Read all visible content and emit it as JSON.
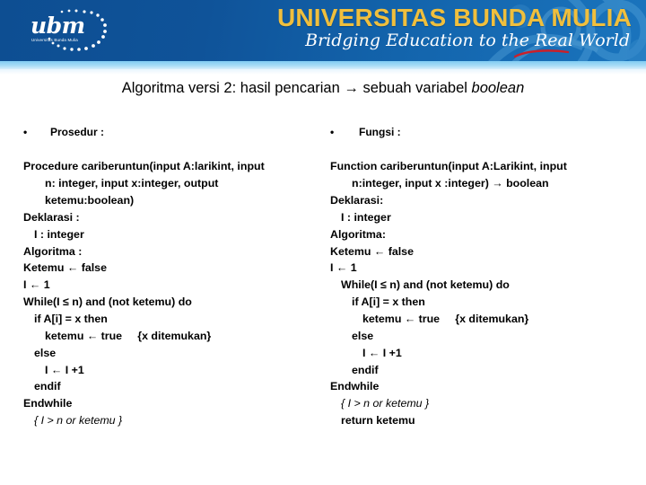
{
  "header": {
    "logo": {
      "mark_text": "ubm",
      "mark_sub": "Universitas Bunda Mulia"
    },
    "university_name": "UNIVERSITAS BUNDA MULIA",
    "tagline": "Bridging Education to the Real World",
    "colors": {
      "banner_dark": "#0d4e92",
      "banner_light": "#1a74bd",
      "strip": "#7fcbf2",
      "gold": "#f0bf3d",
      "swoosh_red": "#c9202a"
    }
  },
  "title": {
    "part1": "Algoritma versi 2: hasil pencarian ",
    "arrow": "→",
    "part2": " sebuah variabel ",
    "emphasis": "boolean"
  },
  "left_column": {
    "bullet": "•",
    "heading": "Prosedur :",
    "code_lines": [
      {
        "text": "Procedure cariberuntun(input A:larikint, input",
        "indent": 0,
        "bold": true,
        "italic": false
      },
      {
        "text": "n: integer, input x:integer, output",
        "indent": 2,
        "bold": true,
        "italic": false
      },
      {
        "text": "ketemu:boolean)",
        "indent": 2,
        "bold": true,
        "italic": false
      },
      {
        "text": "Deklarasi :",
        "indent": 0,
        "bold": true,
        "italic": false
      },
      {
        "text": "I : integer",
        "indent": 1,
        "bold": true,
        "italic": false
      },
      {
        "text": "Algoritma :",
        "indent": 0,
        "bold": true,
        "italic": false
      },
      {
        "text": "Ketemu ← false",
        "indent": 0,
        "bold": true,
        "italic": false
      },
      {
        "text": "I ← 1",
        "indent": 0,
        "bold": true,
        "italic": false
      },
      {
        "text": "While(I ≤ n) and (not ketemu) do",
        "indent": 0,
        "bold": true,
        "italic": false
      },
      {
        "text": "if A[i] = x then",
        "indent": 1,
        "bold": true,
        "italic": false
      },
      {
        "text": "ketemu ← true     {x ditemukan}",
        "indent": 2,
        "bold": true,
        "italic": false
      },
      {
        "text": "else",
        "indent": 1,
        "bold": true,
        "italic": false
      },
      {
        "text": "I ← I +1",
        "indent": 2,
        "bold": true,
        "italic": false
      },
      {
        "text": "endif",
        "indent": 1,
        "bold": true,
        "italic": false
      },
      {
        "text": "Endwhile",
        "indent": 0,
        "bold": true,
        "italic": false
      },
      {
        "text": "{ I > n or ketemu }",
        "indent": 1,
        "bold": false,
        "italic": true
      }
    ]
  },
  "right_column": {
    "bullet": "•",
    "heading": "Fungsi :",
    "code_lines": [
      {
        "text": "Function cariberuntun(input A:Larikint, input",
        "indent": 0,
        "bold": true,
        "italic": false
      },
      {
        "text": "n:integer, input x :integer) → boolean",
        "indent": 2,
        "bold": true,
        "italic": false
      },
      {
        "text": "Deklarasi:",
        "indent": 0,
        "bold": true,
        "italic": false
      },
      {
        "text": "I : integer",
        "indent": 1,
        "bold": true,
        "italic": false
      },
      {
        "text": "Algoritma:",
        "indent": 0,
        "bold": true,
        "italic": false
      },
      {
        "text": "Ketemu ← false",
        "indent": 0,
        "bold": true,
        "italic": false
      },
      {
        "text": "I ← 1",
        "indent": 0,
        "bold": true,
        "italic": false
      },
      {
        "text": "While(I ≤ n) and (not ketemu) do",
        "indent": 1,
        "bold": true,
        "italic": false
      },
      {
        "text": "if A[i] = x then",
        "indent": 2,
        "bold": true,
        "italic": false
      },
      {
        "text": "ketemu ← true     {x ditemukan}",
        "indent": 3,
        "bold": true,
        "italic": false
      },
      {
        "text": "else",
        "indent": 2,
        "bold": true,
        "italic": false
      },
      {
        "text": "I ← I +1",
        "indent": 3,
        "bold": true,
        "italic": false
      },
      {
        "text": "endif",
        "indent": 2,
        "bold": true,
        "italic": false
      },
      {
        "text": "Endwhile",
        "indent": 0,
        "bold": true,
        "italic": false
      },
      {
        "text": "{ I > n or ketemu }",
        "indent": 1,
        "bold": false,
        "italic": true
      },
      {
        "text": "return ketemu",
        "indent": 1,
        "bold": true,
        "italic": false
      }
    ]
  }
}
